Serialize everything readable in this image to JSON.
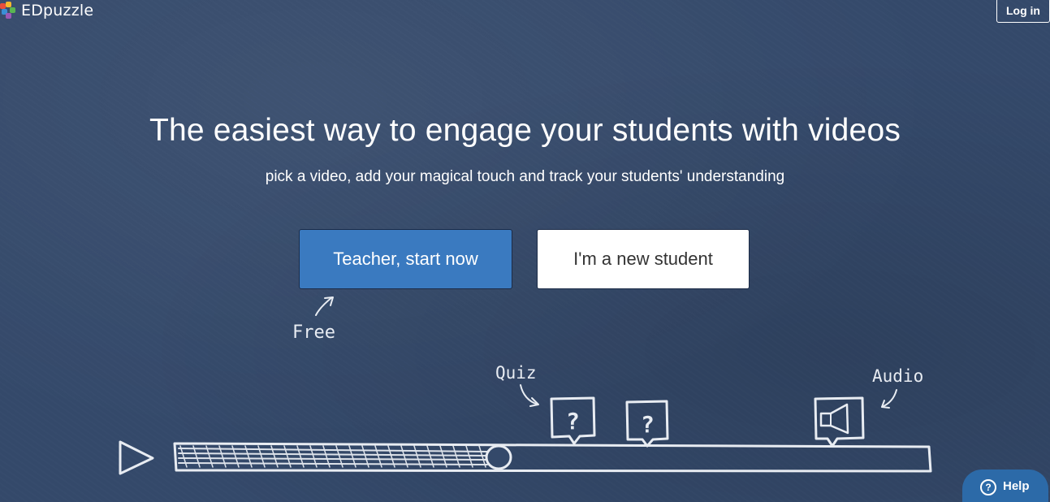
{
  "header": {
    "logo_text": "EDpuzzle",
    "login_label": "Log in"
  },
  "hero": {
    "headline": "The easiest way to engage your students with videos",
    "subline": "pick a video, add your magical touch and track your students' understanding"
  },
  "actions": {
    "teacher_label": "Teacher, start now",
    "student_label": "I'm a new student"
  },
  "illustration": {
    "free_label": "Free",
    "quiz_label": "Quiz",
    "audio_label": "Audio",
    "question_mark": "?"
  },
  "help": {
    "label": "Help",
    "icon_glyph": "?"
  },
  "colors": {
    "background": "#34496a",
    "teacher_button": "#3a7ac0",
    "help_button": "#2c6aa8",
    "chalk": "#e8ecf2"
  },
  "icons": [
    "puzzle-logo-icon",
    "play-icon",
    "question-bubble-icon",
    "megaphone-icon",
    "help-icon"
  ]
}
